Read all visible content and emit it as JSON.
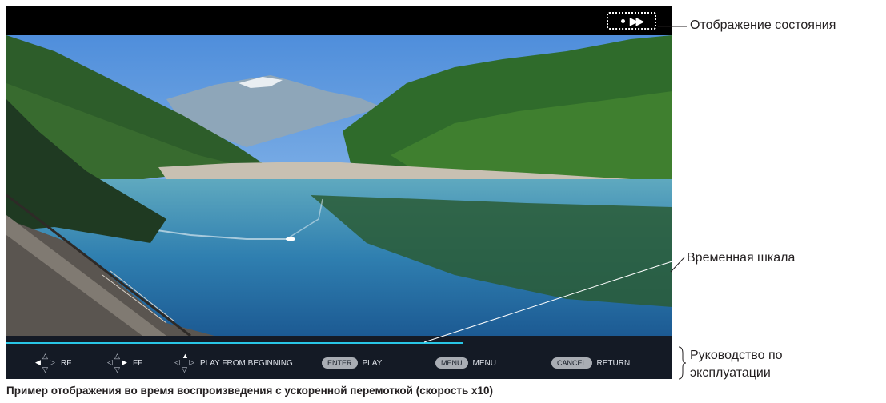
{
  "callouts": {
    "status_display": "Отображение состояния",
    "timeline": "Временная шкала",
    "guide_line1": "Руководство по",
    "guide_line2": "эксплуатации"
  },
  "status": {
    "icon": "fast-forward-status-icon",
    "glyph": "▶▶"
  },
  "progress": {
    "fraction": 0.685,
    "color": "#29c6e6"
  },
  "guide": {
    "rf": {
      "label": "RF",
      "icon": "dpad-left-icon"
    },
    "ff": {
      "label": "FF",
      "icon": "dpad-right-icon"
    },
    "beginning": {
      "label": "PLAY FROM BEGINNING",
      "icon": "dpad-up-icon"
    },
    "enter": {
      "key": "ENTER",
      "label": "PLAY"
    },
    "menu": {
      "key": "MENU",
      "label": "MENU"
    },
    "cancel": {
      "key": "CANCEL",
      "label": "RETURN"
    }
  },
  "caption": "Пример отображения во время воспроизведения с ускоренной перемоткой (скорость x10)"
}
